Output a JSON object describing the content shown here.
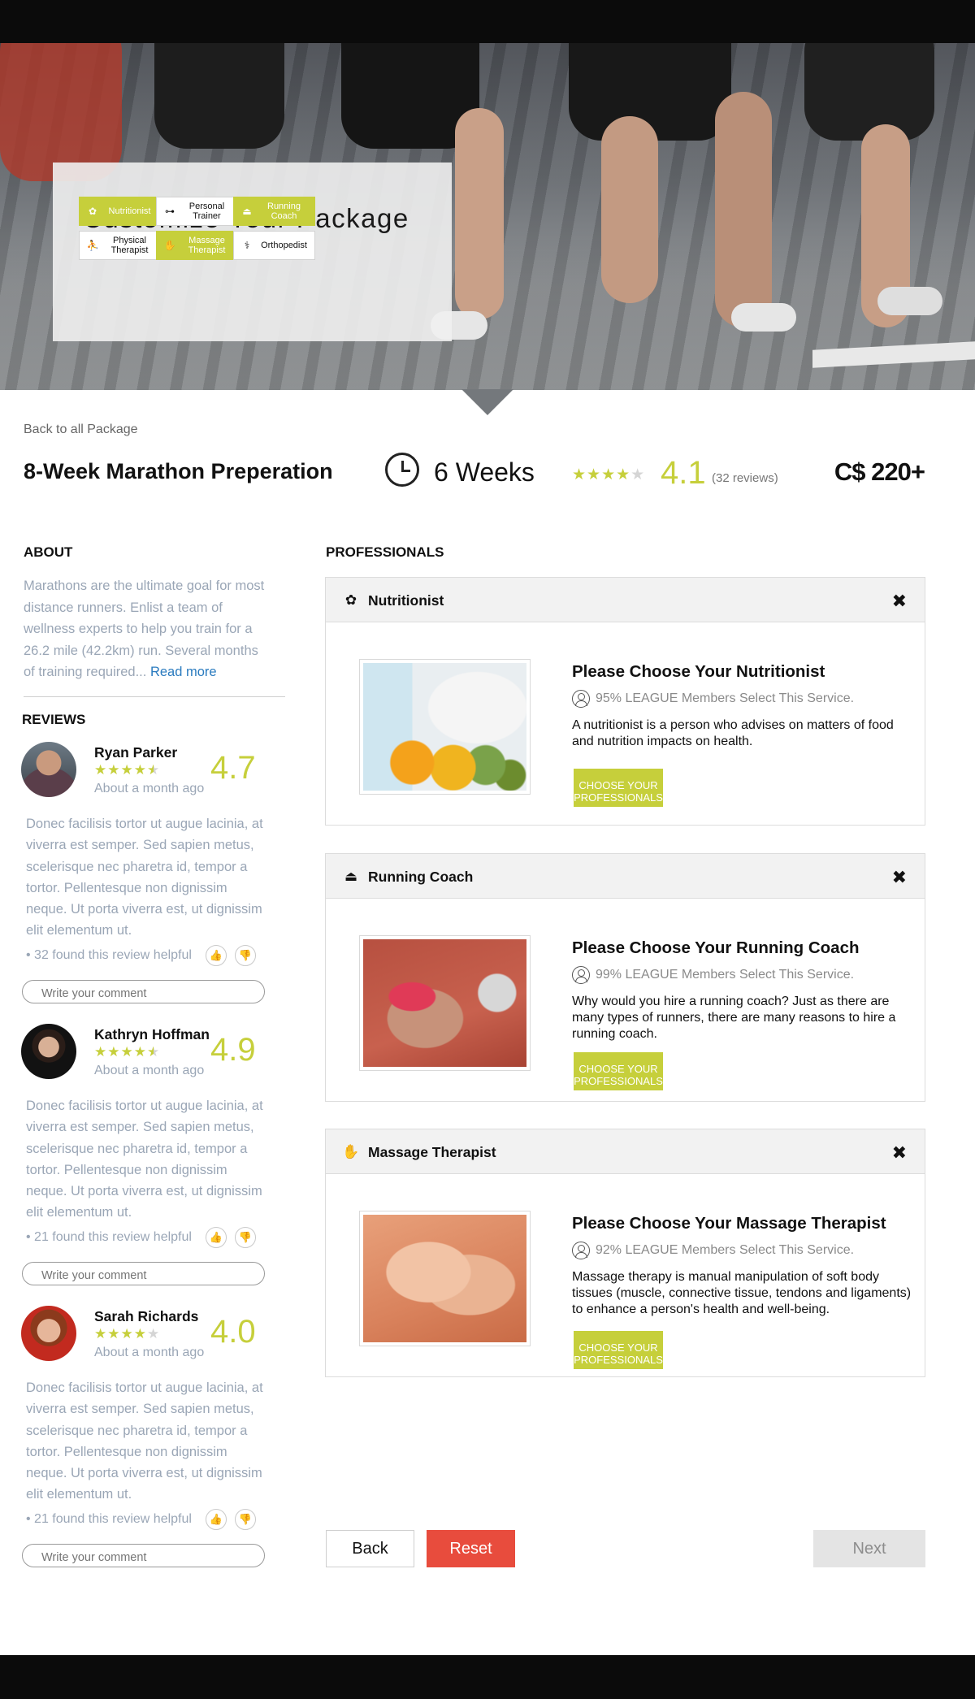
{
  "hero": {
    "title": "Customize Your Package",
    "chips": [
      {
        "label": "Nutritionist",
        "icon": "nutritionist-icon",
        "selected": true
      },
      {
        "label": "Personal Trainer",
        "icon": "dumbbell-icon",
        "selected": false
      },
      {
        "label": "Running Coach",
        "icon": "running-shoe-icon",
        "selected": true
      },
      {
        "label": "Physical Therapist",
        "icon": "physical-therapy-icon",
        "selected": false
      },
      {
        "label": "Massage Therapist",
        "icon": "hand-icon",
        "selected": true
      },
      {
        "label": "Orthopedist",
        "icon": "orthopedist-icon",
        "selected": false
      }
    ]
  },
  "header": {
    "back_link": "Back to all Package",
    "package_name": "8-Week Marathon Preperation",
    "duration": "6 Weeks",
    "rating_stars": 4,
    "rating": "4.1",
    "review_count": "(32 reviews)",
    "price": "C$ 220+"
  },
  "about": {
    "heading": "ABOUT",
    "text": "Marathons are the ultimate goal for most distance runners. Enlist a team of wellness experts to help you train for a 26.2 mile (42.2km) run. Several months of training required...",
    "read_more": "Read more"
  },
  "reviews": {
    "heading": "REVIEWS",
    "comment_placeholder": "Write your comment",
    "items": [
      {
        "name": "Ryan Parker",
        "stars": 4.5,
        "date": "About a month ago",
        "score": "4.7",
        "text": "Donec facilisis tortor ut augue lacinia, at viverra est semper. Sed sapien metus, scelerisque nec pharetra id, tempor a tortor. Pellentesque non dignissim neque. Ut porta viverra est, ut dignissim elit elementum ut.",
        "helpful": "• 32 found this review helpful"
      },
      {
        "name": "Kathryn Hoffman",
        "stars": 4.5,
        "date": "About a month ago",
        "score": "4.9",
        "text": "Donec facilisis tortor ut augue lacinia, at viverra est semper. Sed sapien metus, scelerisque nec pharetra id, tempor a tortor. Pellentesque non dignissim neque. Ut porta viverra est, ut dignissim elit elementum ut.",
        "helpful": "• 21 found this review helpful"
      },
      {
        "name": "Sarah Richards",
        "stars": 4,
        "date": "About a month ago",
        "score": "4.0",
        "text": "Donec facilisis tortor ut augue lacinia, at viverra est semper. Sed sapien metus, scelerisque nec pharetra id, tempor a tortor. Pellentesque non dignissim neque. Ut porta viverra est, ut dignissim elit elementum ut.",
        "helpful": "• 21 found this review helpful"
      }
    ]
  },
  "professionals": {
    "heading": "PROFESSIONALS",
    "cta_label": "CHOOSE YOUR PROFESSIONALS",
    "cards": [
      {
        "name": "Nutritionist",
        "icon": "nutritionist-icon",
        "title": "Please Choose Your Nutritionist",
        "stat": "95% LEAGUE Members Select This Service.",
        "desc": "A nutritionist is a person who advises on matters of food and nutrition impacts on health."
      },
      {
        "name": "Running Coach",
        "icon": "running-shoe-icon",
        "title": "Please Choose Your Running Coach",
        "stat": "99% LEAGUE Members Select This Service.",
        "desc": "Why would you hire a running coach? Just as there are many types of runners, there are many reasons to hire a running coach."
      },
      {
        "name": "Massage Therapist",
        "icon": "hand-icon",
        "title": "Please Choose Your Massage Therapist",
        "stat": "92% LEAGUE Members Select This Service.",
        "desc": "Massage therapy is manual manipulation of soft body tissues (muscle, connective tissue, tendons and ligaments) to enhance a person's health and well-being."
      }
    ]
  },
  "footer": {
    "back": "Back",
    "reset": "Reset",
    "next": "Next"
  },
  "colors": {
    "accent": "#c6cf3b",
    "reset": "#e84c3d",
    "muted_text": "#9aa6b6",
    "link": "#2a7bbf"
  }
}
